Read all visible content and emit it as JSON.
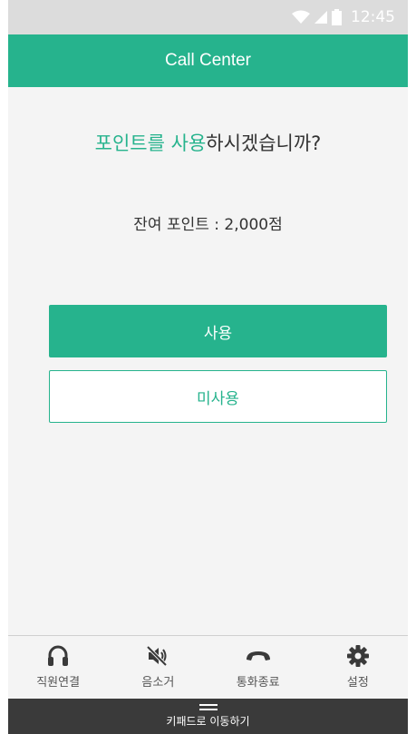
{
  "status_bar": {
    "time": "12:45"
  },
  "header": {
    "title": "Call Center"
  },
  "prompt": {
    "highlight_1": "포인트를",
    "space": " ",
    "highlight_2": "사용",
    "rest": "하시겠습니까?"
  },
  "balance": {
    "text": "잔여 포인트 : 2,000점"
  },
  "buttons": {
    "use_label": "사용",
    "skip_label": "미사용"
  },
  "bottom_nav": [
    {
      "label": "직원연결",
      "icon": "headset-icon"
    },
    {
      "label": "음소거",
      "icon": "mute-icon"
    },
    {
      "label": "통화종료",
      "icon": "hangup-icon"
    },
    {
      "label": "설정",
      "icon": "gear-icon"
    }
  ],
  "keypad": {
    "label": "키패드로 이동하기"
  },
  "colors": {
    "accent": "#26b38d",
    "status_bar": "#dcdcdc",
    "keypad_bar": "#3a3a3a"
  }
}
